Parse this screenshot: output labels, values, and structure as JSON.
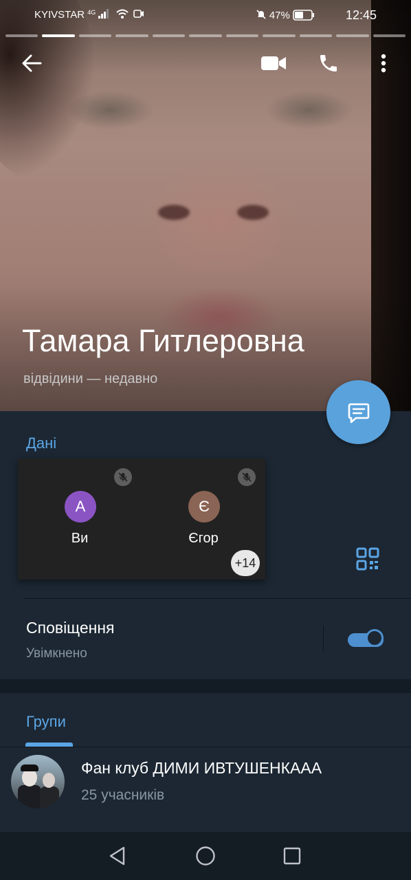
{
  "status_bar": {
    "carrier": "KYIVSTAR",
    "network": "4G",
    "battery": "47%",
    "time": "12:45"
  },
  "profile": {
    "name": "Тамара Гитлеровна",
    "last_seen": "відвідини — недавно"
  },
  "info": {
    "heading": "Дані"
  },
  "voice_chat": {
    "participants": [
      {
        "initial": "А",
        "name": "Ви",
        "color": "#8b54c3"
      },
      {
        "initial": "Є",
        "name": "Єгор",
        "color": "#8a6454"
      }
    ],
    "more_count": "+14"
  },
  "notifications": {
    "title": "Сповіщення",
    "value": "Увімкнено",
    "enabled": true
  },
  "groups": {
    "heading": "Групи",
    "items": [
      {
        "title": "Фан клуб ДИМИ ИВТУШЕНКААА",
        "members": "25 учасників"
      }
    ]
  },
  "colors": {
    "accent": "#5ba6e5",
    "background": "#1c2733",
    "fab": "#5aa2dc"
  },
  "icons": [
    "back-arrow-icon",
    "video-camera-icon",
    "phone-icon",
    "more-vertical-icon",
    "message-icon",
    "qr-code-icon",
    "mic-off-icon",
    "nav-back-icon",
    "nav-home-icon",
    "nav-recent-icon"
  ]
}
